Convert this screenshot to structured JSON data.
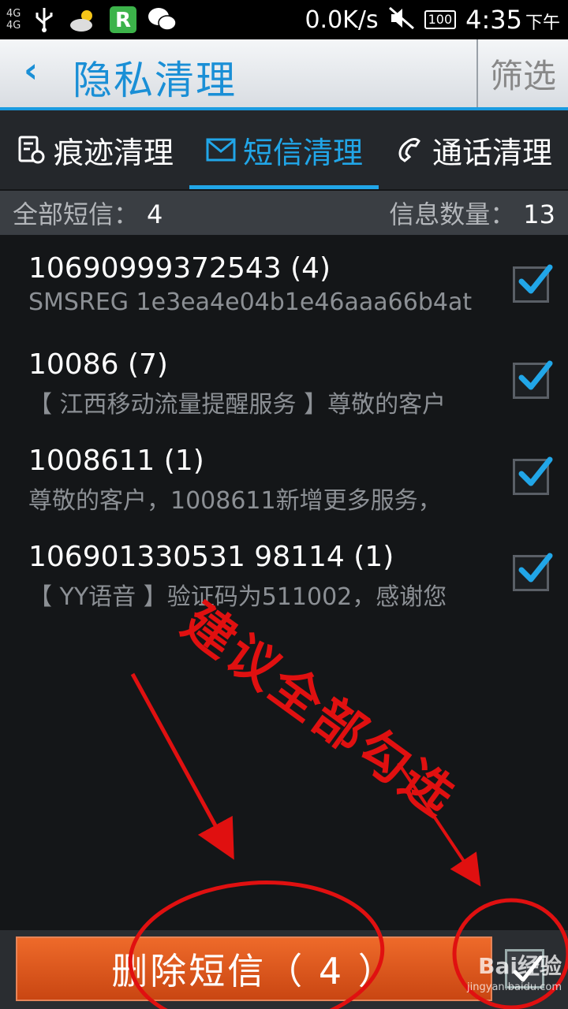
{
  "status_bar": {
    "signal_1": "4G",
    "signal_2": "4G",
    "speed": "0.0K/s",
    "battery": "100",
    "time": "4:35",
    "ampm": "下午",
    "icons": [
      "signal-icon",
      "usb-icon",
      "weather-icon",
      "r-app-icon",
      "wechat-icon",
      "mute-icon",
      "battery-icon"
    ]
  },
  "header": {
    "back_icon": "chevron-left-icon",
    "title": "隐私清理",
    "filter_label": "筛选"
  },
  "tabs": [
    {
      "label": "痕迹清理",
      "icon": "trace-icon",
      "active": false
    },
    {
      "label": "短信清理",
      "icon": "mail-icon",
      "active": true
    },
    {
      "label": "通话清理",
      "icon": "phone-icon",
      "active": false
    }
  ],
  "summary": {
    "all_label": "全部短信：",
    "all_value": "4",
    "count_label": "信息数量：",
    "count_value": "13"
  },
  "messages": [
    {
      "sender": "10690999372543 (4)",
      "preview": "SMSREG 1e3ea4e04b1e46aaa66b4at",
      "checked": true
    },
    {
      "sender": "10086 (7)",
      "preview": "【 江西移动流量提醒服务 】尊敬的客户",
      "checked": true
    },
    {
      "sender": "1008611 (1)",
      "preview": "尊敬的客户，1008611新增更多服务，",
      "checked": true
    },
    {
      "sender": "106901330531 98114 (1)",
      "preview": "【 YY语音 】验证码为511002，感谢您",
      "checked": true
    }
  ],
  "annotation": {
    "text": "建议全部勾选",
    "color": "#e01010"
  },
  "footer": {
    "delete_label": "删除短信（ 4 ）",
    "select_all_checked": false,
    "watermark": "Bai经验",
    "watermark_sub": "jingyan.baidu.com"
  },
  "colors": {
    "accent": "#21a6e8",
    "delete_button": "#e05a1e",
    "annotation": "#e01010"
  }
}
